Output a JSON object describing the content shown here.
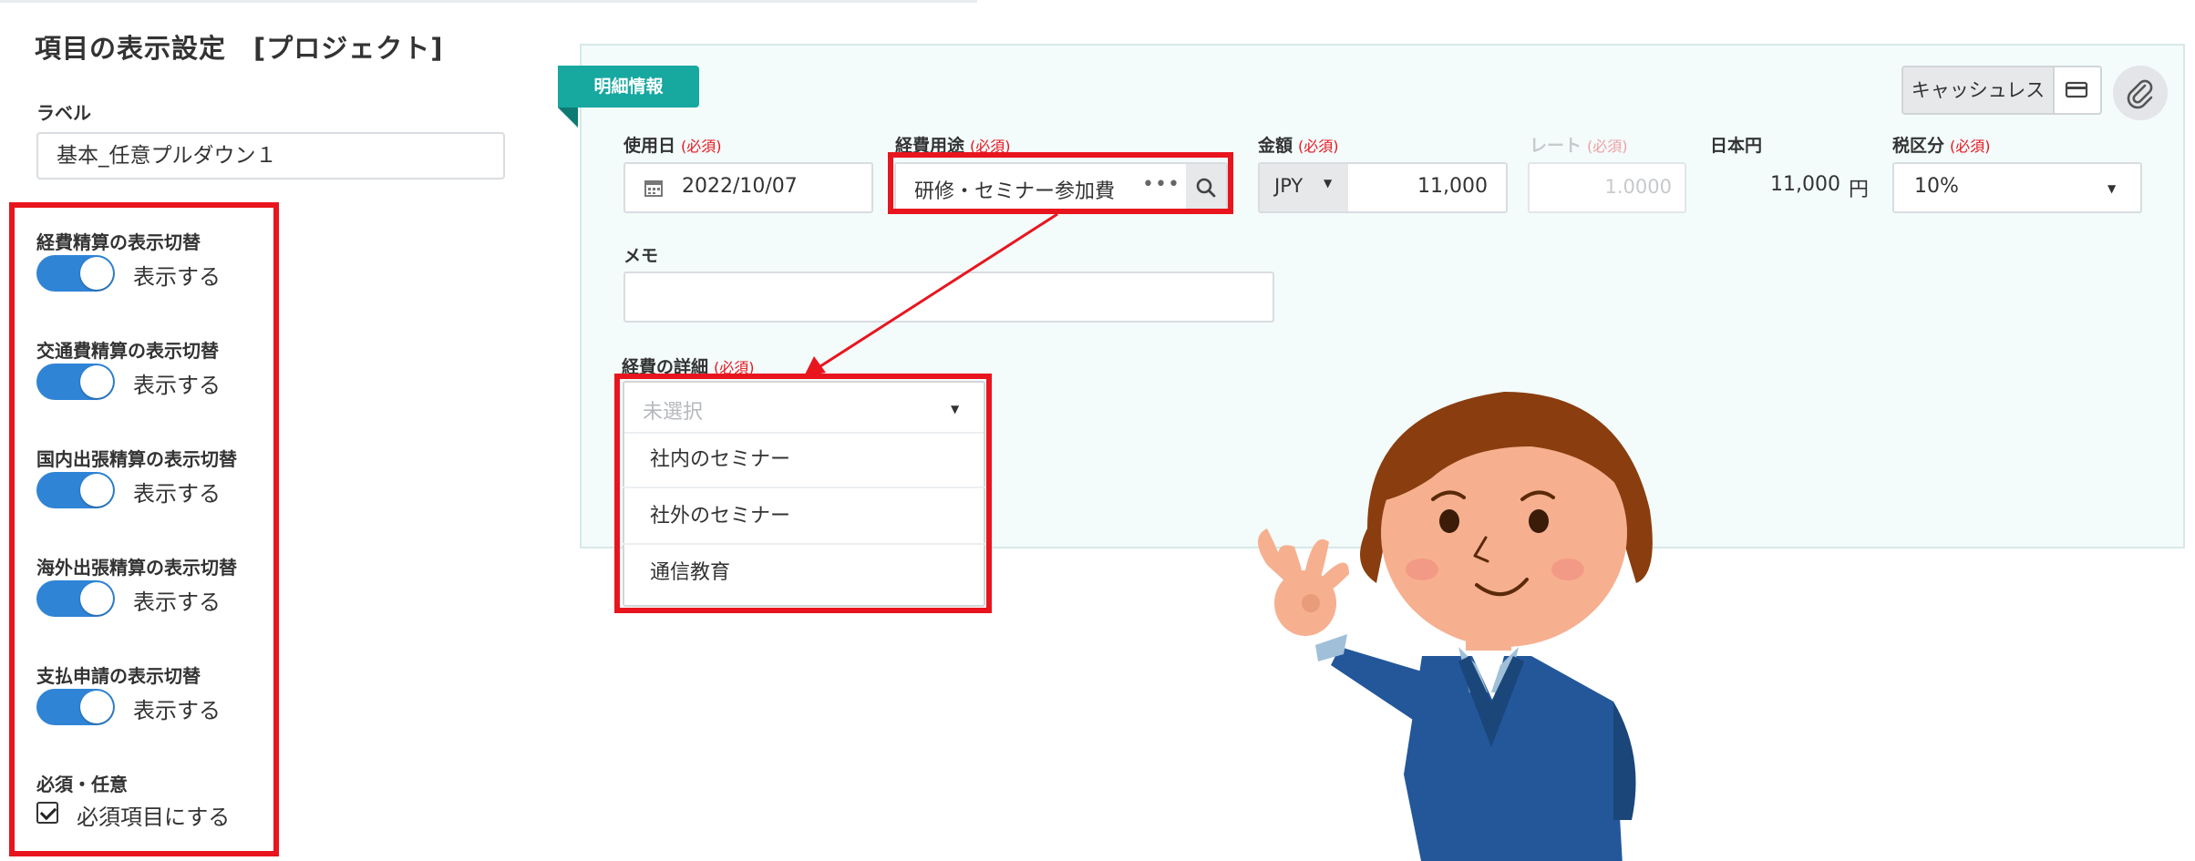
{
  "settings_panel": {
    "title": "項目の表示設定　[プロジェクト]",
    "label_heading": "ラベル",
    "label_value": "基本_任意プルダウン１",
    "toggles": [
      {
        "heading": "経費精算の表示切替",
        "state_text": "表示する",
        "on": true
      },
      {
        "heading": "交通費精算の表示切替",
        "state_text": "表示する",
        "on": true
      },
      {
        "heading": "国内出張精算の表示切替",
        "state_text": "表示する",
        "on": true
      },
      {
        "heading": "海外出張精算の表示切替",
        "state_text": "表示する",
        "on": true
      },
      {
        "heading": "支払申請の表示切替",
        "state_text": "表示する",
        "on": true
      }
    ],
    "required_heading": "必須・任意",
    "required_checkbox_label": "必須項目にする",
    "required_checked": true
  },
  "detail_form": {
    "tag": "明細情報",
    "cashless_button": "キャッシュレス",
    "card_icon": "credit-card-icon",
    "attach_icon": "paperclip-icon",
    "required_mark": "(必須)",
    "date": {
      "label": "使用日",
      "value": "2022/10/07",
      "icon": "calendar-icon"
    },
    "purpose": {
      "label": "経費用途",
      "value": "研修・セミナー参加費",
      "more_icon": "ellipsis-icon",
      "search_icon": "search-icon"
    },
    "amount": {
      "label": "金額",
      "currency": "JPY",
      "value": "11,000"
    },
    "rate": {
      "label": "レート",
      "placeholder": "1.0000"
    },
    "jpy": {
      "label": "日本円",
      "value": "11,000",
      "unit": "円"
    },
    "tax": {
      "label": "税区分",
      "value": "10%"
    },
    "memo": {
      "label": "メモ",
      "value": ""
    },
    "detail": {
      "label": "経費の詳細",
      "placeholder": "未選択",
      "options": [
        "社内のセミナー",
        "社外のセミナー",
        "通信教育"
      ]
    }
  },
  "colors": {
    "highlight_red": "#e8151e",
    "toggle_blue": "#2f84d6",
    "tag_teal": "#17a8a0",
    "card_bg": "#f3fbfb"
  },
  "illustration": "woman-ok-gesture-illustration"
}
